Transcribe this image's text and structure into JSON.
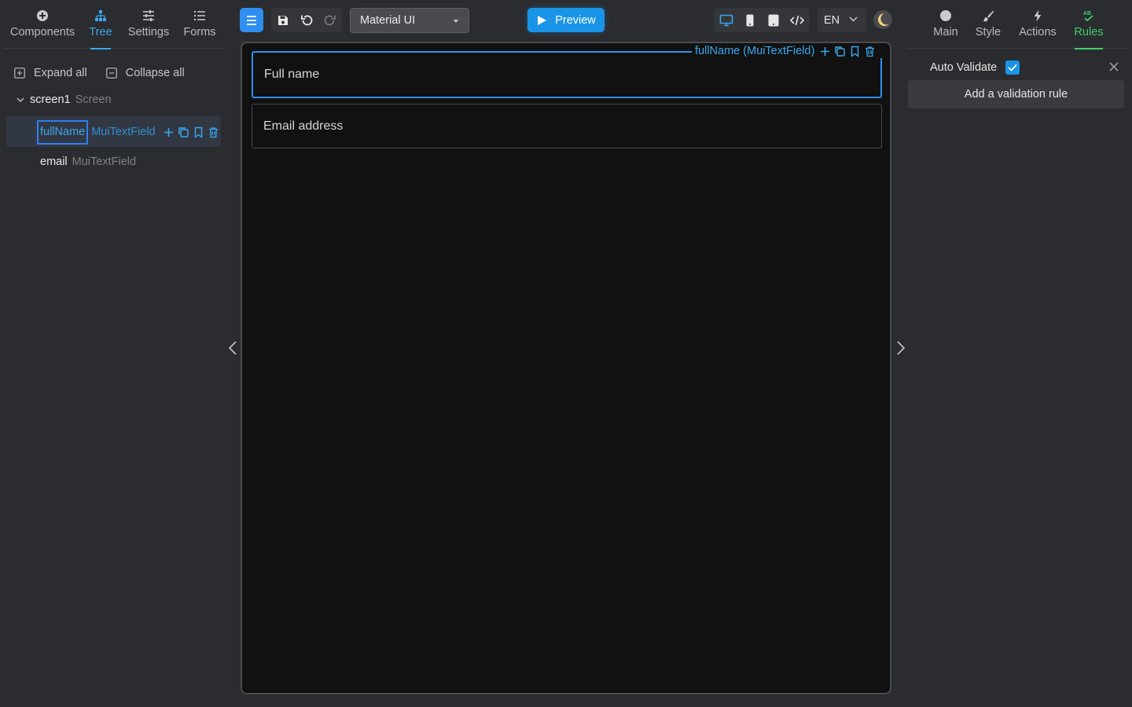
{
  "colors": {
    "accent": "#2f8ff0",
    "accent_text": "#3aa7ee",
    "rules_active": "#3fcf6b",
    "canvas_bg": "#111111",
    "panel_bg": "#2b2c2f"
  },
  "left_tabs": [
    {
      "label": "Components",
      "icon": "plus-circle-icon"
    },
    {
      "label": "Tree",
      "icon": "hierarchy-icon",
      "active": true
    },
    {
      "label": "Settings",
      "icon": "sliders-icon"
    },
    {
      "label": "Forms",
      "icon": "list-icon"
    }
  ],
  "tree": {
    "expand_all": "Expand all",
    "collapse_all": "Collapse all",
    "root": {
      "name": "screen1",
      "type": "Screen"
    },
    "children": [
      {
        "name": "fullName",
        "type": "MuiTextField",
        "selected": true
      },
      {
        "name": "email",
        "type": "MuiTextField"
      }
    ]
  },
  "toolbar": {
    "library": "Material UI",
    "preview": "Preview",
    "language": "EN"
  },
  "canvas": {
    "selection_badge": "fullName (MuiTextField)",
    "fields": [
      {
        "label": "Full name"
      },
      {
        "label": "Email address"
      }
    ]
  },
  "right_tabs": [
    {
      "label": "Main",
      "icon": "circle-icon"
    },
    {
      "label": "Style",
      "icon": "brush-icon"
    },
    {
      "label": "Actions",
      "icon": "bolt-icon"
    },
    {
      "label": "Rules",
      "icon": "ab-check-icon",
      "active": true
    }
  ],
  "rules": {
    "auto_validate_label": "Auto Validate",
    "auto_validate_checked": true,
    "add_rule": "Add a validation rule"
  }
}
